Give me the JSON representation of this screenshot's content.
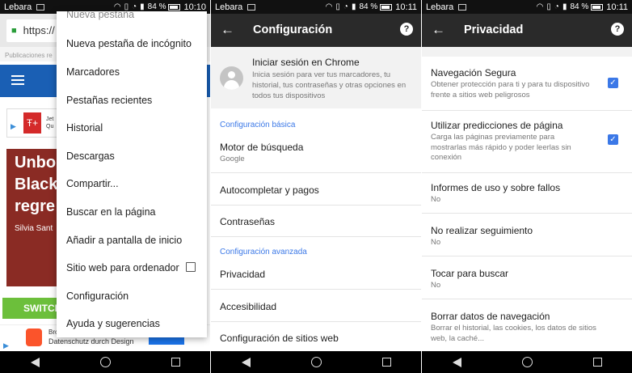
{
  "status": {
    "carrier": "Lebara",
    "battery": "84 %",
    "times": [
      "10:10",
      "10:11",
      "10:11"
    ]
  },
  "panel1": {
    "url_text": "https://",
    "pubs_text": "Publicaciones re",
    "ad1_text": "Jet\nQu",
    "hero_title_lines": [
      "Unbo",
      "Black",
      "regre"
    ],
    "hero_author": "Silvia Sant",
    "switch_label": "SWITCH",
    "ad2_line1": "Bro",
    "ad2_line2": "Datenschutz durch Design",
    "menu": {
      "items": [
        "Nueva pestaña",
        "Nueva pestaña de incógnito",
        "Marcadores",
        "Pestañas recientes",
        "Historial",
        "Descargas",
        "Compartir...",
        "Buscar en la página",
        "Añadir a pantalla de inicio",
        "Sitio web para ordenador",
        "Configuración",
        "Ayuda y sugerencias"
      ]
    }
  },
  "panel2": {
    "title": "Configuración",
    "signin_title": "Iniciar sesión en Chrome",
    "signin_desc": "Inicia sesión para ver tus marcadores, tu historial, tus contraseñas y otras opciones en todos tus dispositivos",
    "section_basic": "Configuración básica",
    "search_engine_label": "Motor de búsqueda",
    "search_engine_value": "Google",
    "autofill_label": "Autocompletar y pagos",
    "passwords_label": "Contraseñas",
    "section_advanced": "Configuración avanzada",
    "privacy_label": "Privacidad",
    "accessibility_label": "Accesibilidad",
    "site_settings_label": "Configuración de sitios web"
  },
  "panel3": {
    "title": "Privacidad",
    "safe_browsing_title": "Navegación Segura",
    "safe_browsing_desc": "Obtener protección para ti y para tu dispositivo frente a sitios web peligrosos",
    "predictions_title": "Utilizar predicciones de página",
    "predictions_desc": "Carga las páginas previamente para mostrarlas más rápido y poder leerlas sin conexión",
    "usage_title": "Informes de uso y sobre fallos",
    "usage_value": "No",
    "dnt_title": "No realizar seguimiento",
    "dnt_value": "No",
    "tap_search_title": "Tocar para buscar",
    "tap_search_value": "No",
    "clear_title": "Borrar datos de navegación",
    "clear_desc": "Borrar el historial, las cookies, los datos de sitios web, la caché..."
  }
}
